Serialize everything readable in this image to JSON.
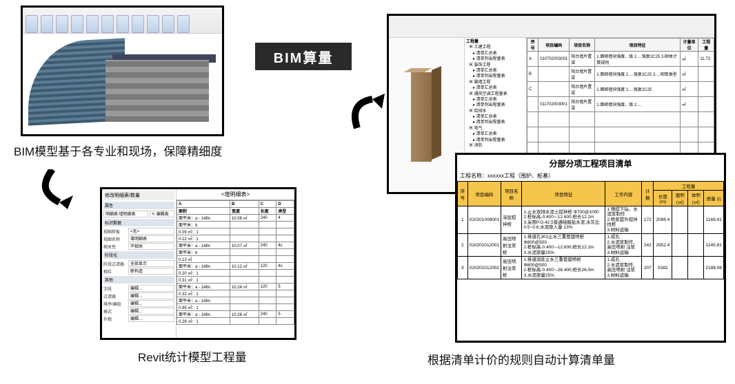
{
  "captions": {
    "topLeft": "BIM模型基于各专业和现场，保障精细度",
    "bottomLeft": "Revit统计模型工程量",
    "bottomRight": "根据清单计价的规则自动计算清单量"
  },
  "centerLabel": "BIM算量",
  "panel2": {
    "dialogTitle": "修改明细表/数量",
    "prop": "属性",
    "tableTitle": "<增明细表>",
    "headerCols": [
      "A",
      "B",
      "C",
      "D"
    ],
    "headerFields": [
      "面积",
      "宽度",
      "长度",
      "类型"
    ],
    "leftFields": {
      "mxdName": "明细表:墙明细表",
      "btn": "✎ 编辑类型",
      "sec1": "标识数据",
      "row1a": "视图样板",
      "row1b": "<无>",
      "row2a": "视图名称",
      "row2b": "增明细表",
      "row3a": "相关性",
      "row3b": "不相关",
      "sec2": "阶段化",
      "row4a": "阶段过滤器",
      "row4b": "全部显示",
      "row5a": "相位",
      "row5b": "新构造",
      "sec3": "其他",
      "row6a": "字段",
      "row6b": "编辑…",
      "row7a": "过滤器",
      "row7b": "编辑…",
      "row8a": "排序/编组",
      "row8b": "编辑…",
      "row9a": "格式",
      "row9b": "编辑…",
      "row10a": "外观",
      "row10b": "编辑…"
    },
    "rows": [
      [
        "面平米：a - 148n",
        "10.08 ㎡",
        "240",
        "4"
      ],
      [
        "面平米：b",
        "",
        "",
        ""
      ],
      [
        "0.09 ㎡：1",
        "",
        "",
        ""
      ],
      [
        "0.12 ㎡：1",
        "",
        "",
        ""
      ],
      [
        "面平米：a - 148n",
        "10.07 ㎡",
        "240",
        "4c"
      ],
      [
        "面平米：b",
        "",
        "",
        ""
      ],
      [
        "0.13 ㎡",
        "",
        "",
        ""
      ],
      [
        "面平米：a - 148n",
        "10.12 ㎡",
        "120",
        "4c"
      ],
      [
        "0.20 ㎡：1",
        "",
        "",
        ""
      ],
      [
        "0.31 ㎡：1",
        "",
        "",
        ""
      ],
      [
        "面平米：a - 148n",
        "10.24 ㎡",
        "120",
        "5"
      ],
      [
        "0.32 ㎡：1",
        "",
        "",
        ""
      ],
      [
        "面平米：a - 148n",
        "",
        "",
        ""
      ],
      [
        "0.95 ㎡：1",
        "",
        "",
        ""
      ],
      [
        "面平米：a - 148n",
        "10.28 ㎡",
        "240",
        "5"
      ],
      [
        "0.28 ㎡：1",
        "",
        "",
        ""
      ]
    ]
  },
  "panel3": {
    "treeTitle": "工程量",
    "tree": [
      "▣ 土建工程",
      "  ▸ 清单汇总表",
      "  ▸ 清单列出程量表",
      "▣ 装饰工程",
      "  ▸ 清单汇总表",
      "  ▸ 清单列出程量表",
      "▣ 幕墙工程",
      "  ▸ 清单汇总表",
      "▣ 通风空调工程量表",
      "  ▸ 清单汇总表",
      "  ▸ 清单列出程量表",
      "▣ 给排水",
      "  ▸ 清单汇总表",
      "  ▸ 清单列出程量表",
      "▣ 电气",
      "  ▸ 清单汇总表",
      "  ▸ 清单列出程量表",
      "▣ 消防"
    ],
    "cols": [
      "序号",
      "项目编码",
      "项目名称",
      "项目特征",
      "计量单位",
      "工程量"
    ],
    "rows": [
      [
        "A",
        "010702003001",
        "阳台墙片置梁",
        "1.面砌墙块强度、级\n2.…强复2C25\n3.砌体计算规则",
        "㎡",
        "11.73"
      ],
      [
        "B",
        "",
        "阳台墙片置梁",
        "1.面砌墙块强度\n2.…强复2C25\n3.…砌筑类型",
        "㎡",
        ""
      ],
      [
        "C",
        "",
        "阳台墙片置梁",
        "1.面砌墙块强度\n2.…强复2C25",
        "㎡",
        ""
      ],
      [
        "",
        "011702003001",
        "阳台墙片置梁",
        "1.面砌墙块强度、级\n2.…",
        "㎡",
        ""
      ],
      [
        "",
        "",
        "",
        "",
        "",
        ""
      ],
      [
        "",
        "",
        "",
        "",
        "",
        ""
      ],
      [
        "",
        "",
        "",
        "",
        "",
        ""
      ]
    ]
  },
  "panel4": {
    "title": "分部分项工程项目清单",
    "subtitle": "工程名称：xxxxxx工程（围护、桩基）",
    "headTop": [
      "序号",
      "项目编码",
      "项目名称",
      "项目特征",
      "工作内容",
      "计数",
      "工程量"
    ],
    "headBot": [
      "长度 (m)",
      "面积 (㎡)",
      "体积 (㎡)",
      "质量 (t)"
    ],
    "rows": [
      {
        "idx": "1",
        "code": "010201008001",
        "name": "深层搅拌桩",
        "feature": "1.止水双排水泥土搅拌桩 Φ700@1000\n2.桩标高-0.400~-12.600,桩长12.2m\n3.采用P.O.42.5普通硅酸盐水泥,水灰比 0.5~0.6,水泥掺入量 13%",
        "content": "1.预搅下钻、水泥浆制作\n2.喷浆提升搅拌找桩\n3.材料运输",
        "cnt": "172",
        "len": "2088.4",
        "area": "",
        "vol": "",
        "mass": "1169.41"
      },
      {
        "idx": "2",
        "code": "010201012001",
        "name": "高压喷射注浆桩",
        "feature": "1.排道孔302止水三重管旋喷桩Φ800@500\n2.桩标高-0.400~-12.600,桩长12.2m\n3.水泥掺量25%",
        "content": "1.成孔\n2.水泥浆制作、高压喷射 注浆\n3.材料运输",
        "cnt": "242",
        "len": "2952.4",
        "area": "",
        "vol": "",
        "mass": "1145.81"
      },
      {
        "idx": "3",
        "code": "010201012002",
        "name": "高压喷射注浆桩",
        "feature": "1.排道润处止水三重管旋喷桩Φ800@500\n2.桩标高-0.400~-26.400,桩长26.0m\n3.水泥掺量25%",
        "content": "1.成孔\n2.水泥浆制作、高压喷射 注浆\n3.材料运输",
        "cnt": "207",
        "len": "5382",
        "area": "",
        "vol": "",
        "mass": "2188.06"
      }
    ]
  }
}
